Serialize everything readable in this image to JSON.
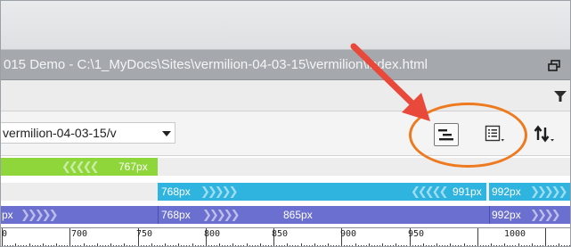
{
  "window": {
    "title": "015 Demo - C:\\1_MyDocs\\Sites\\vermilion-04-03-15\\vermilion\\index.html"
  },
  "toolbar": {
    "path_value": "vermilion-04-03-15/v"
  },
  "media_queries": {
    "row1": {
      "green_label": "767px"
    },
    "row2": {
      "cyan_start_label": "768px",
      "cyan_end_label": "991px",
      "cyan2_start_label": "992px"
    },
    "row3": {
      "purple_partial_label": "px",
      "purple_mid_label": "768px",
      "purple_mid2_label": "865px",
      "purple_end_label": "992px"
    }
  },
  "ruler": {
    "labels": [
      "0",
      "700",
      "750",
      "800",
      "850",
      "900",
      "950",
      "1000"
    ]
  },
  "colors": {
    "annotation": "#ee7a1f",
    "arrow": "#e8493a",
    "green_bar": "#8ed63a",
    "cyan_bar": "#2fb3df",
    "purple_bar": "#6b6fcf"
  }
}
